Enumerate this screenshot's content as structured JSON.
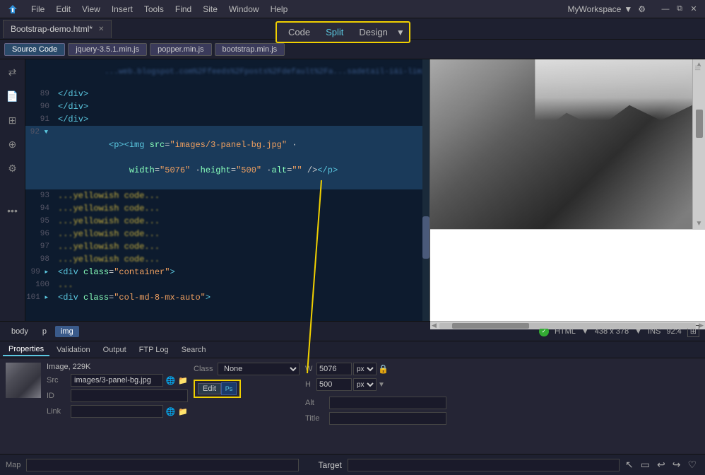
{
  "menubar": {
    "items": [
      "File",
      "Edit",
      "View",
      "Insert",
      "Tools",
      "Find",
      "Site",
      "Window",
      "Help"
    ],
    "workspace": "MyWorkspace",
    "logo_color": "#f00"
  },
  "view_toggle": {
    "code_label": "Code",
    "split_label": "Split",
    "design_label": "Design",
    "active": "Split"
  },
  "tabbar": {
    "active_file": "Bootstrap-demo.html*",
    "tabs": [
      "Bootstrap-demo.html*",
      "jquery-3.5.1.min.js",
      "popper.min.js",
      "bootstrap.min.js"
    ]
  },
  "sourcebar": {
    "buttons": [
      "Source Code",
      "jquery-3.5.1.min.js",
      "popper.min.js",
      "bootstrap.min.js"
    ]
  },
  "code_editor": {
    "lines": [
      {
        "num": "",
        "content": "...blurred url content..."
      },
      {
        "num": "89",
        "content": "</div>"
      },
      {
        "num": "90",
        "content": "</div>"
      },
      {
        "num": "91",
        "content": "</div>"
      },
      {
        "num": "92",
        "content": "<p><img src=\"images/3-panel-bg.jpg\" · width=\"5076\" · height=\"500\" · alt=\"\" /></p>",
        "highlighted": true
      },
      {
        "num": "93",
        "content": "..."
      },
      {
        "num": "94",
        "content": "..."
      },
      {
        "num": "95",
        "content": "..."
      },
      {
        "num": "96",
        "content": "..."
      },
      {
        "num": "97",
        "content": "..."
      },
      {
        "num": "98",
        "content": "..."
      },
      {
        "num": "99",
        "content": "<div·class=\"container\">"
      },
      {
        "num": "100",
        "content": "..."
      },
      {
        "num": "101",
        "content": "<div·class=\"col-md-8-mx-auto\">"
      }
    ]
  },
  "breadcrumb": {
    "items": [
      "body",
      "p",
      "img"
    ]
  },
  "status": {
    "html_label": "HTML",
    "dimensions": "438 x 378",
    "mode": "INS",
    "zoom": "92:4"
  },
  "props_panel": {
    "tabs": [
      "Properties",
      "Validation",
      "Output",
      "FTP Log",
      "Search"
    ],
    "active_tab": "Properties",
    "image_info": "Image, 229K",
    "src_value": "images/3-panel-bg.jpg",
    "id_label": "ID",
    "id_value": "",
    "link_label": "Link",
    "link_value": "",
    "class_label": "Class",
    "class_value": "None",
    "edit_label": "Edit",
    "w_label": "W",
    "w_value": "5076",
    "h_label": "H",
    "h_value": "500",
    "alt_label": "Alt",
    "title_label": "Title",
    "src_label": "Src",
    "unit_px": "px",
    "map_label": "Map",
    "target_label": "Target"
  }
}
